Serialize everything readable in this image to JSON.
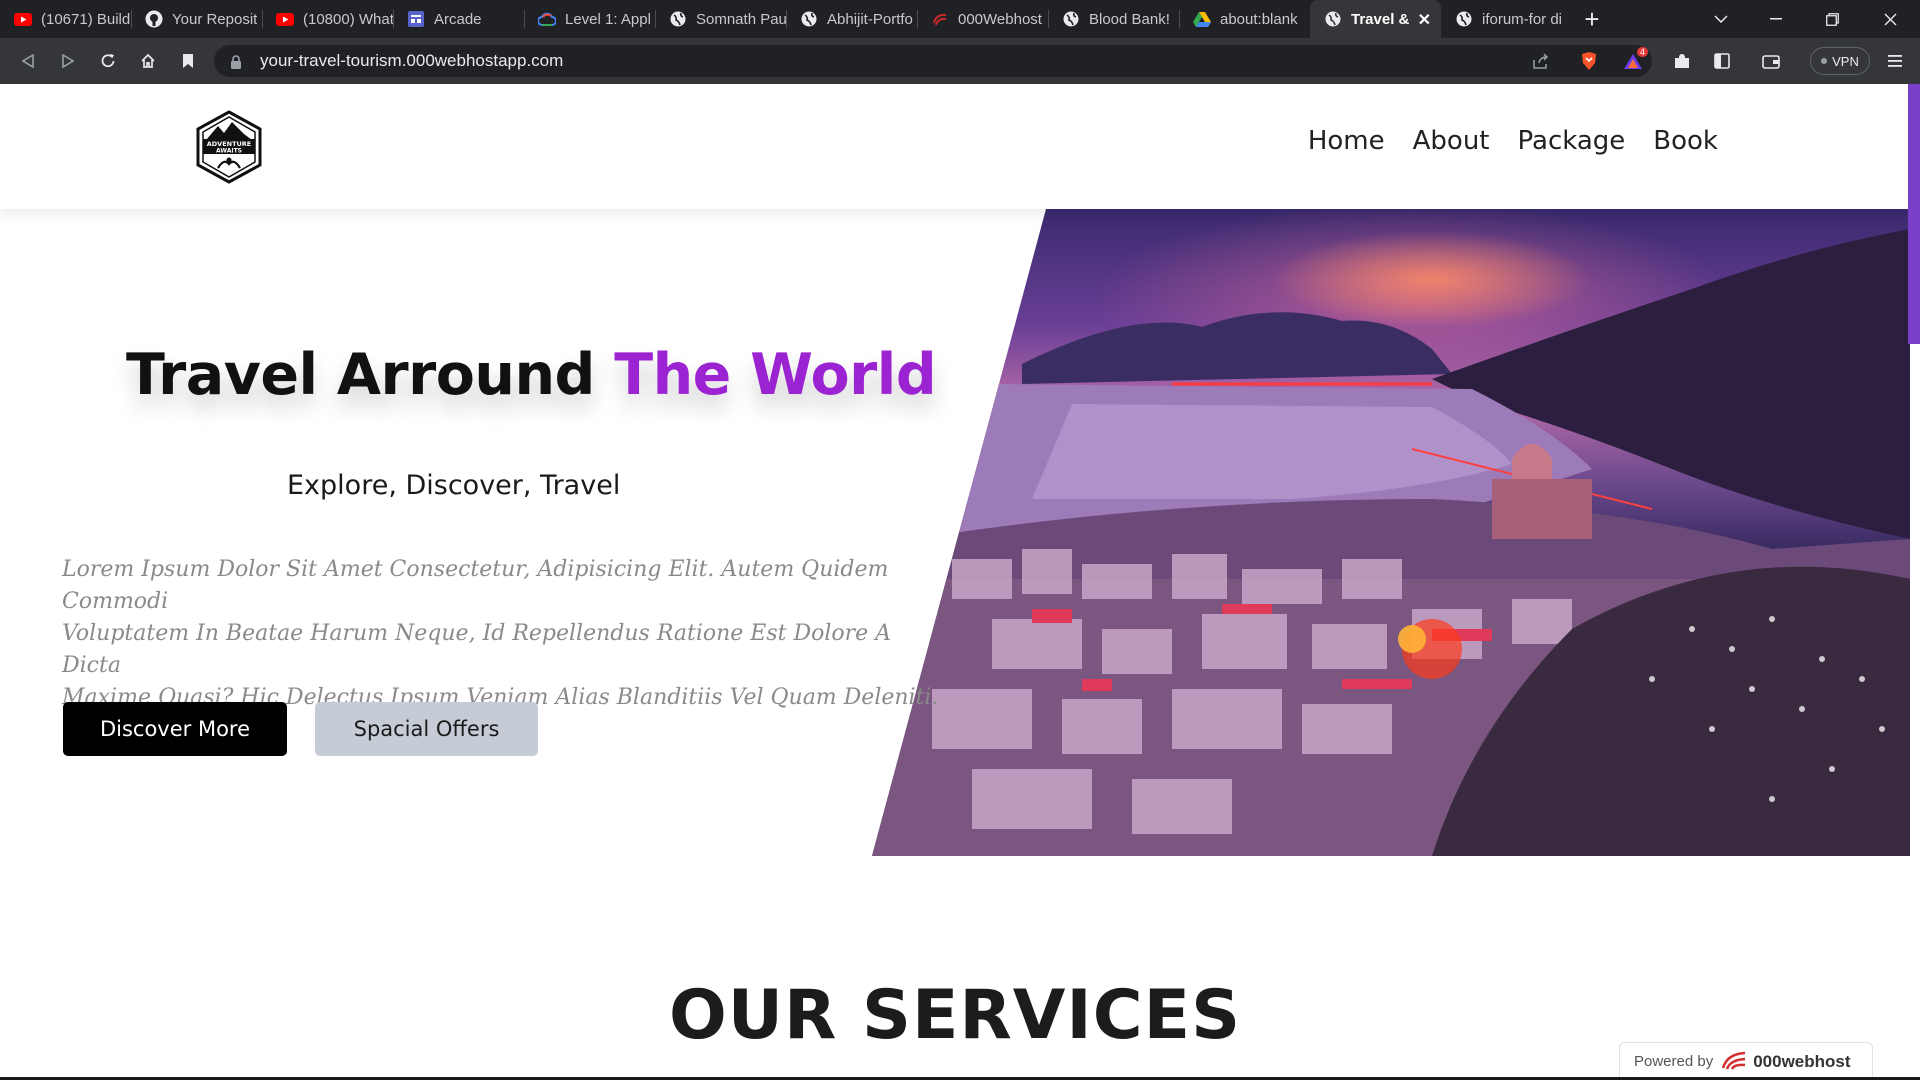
{
  "browser": {
    "tabs": [
      {
        "title": "(10671) Build",
        "icon": "youtube-icon"
      },
      {
        "title": "Your Reposit",
        "icon": "github-icon"
      },
      {
        "title": "(10800) What",
        "icon": "youtube-icon"
      },
      {
        "title": "Arcade",
        "icon": "arcade-icon"
      },
      {
        "title": "Level 1: Appl",
        "icon": "google-cloud-icon"
      },
      {
        "title": "Somnath Pau",
        "icon": "globe-icon"
      },
      {
        "title": "Abhijit-Portfo",
        "icon": "globe-icon"
      },
      {
        "title": "000Webhost",
        "icon": "webhost-icon"
      },
      {
        "title": "Blood Bank!",
        "icon": "globe-icon"
      },
      {
        "title": "about:blank",
        "icon": "google-drive-icon"
      },
      {
        "title": "Travel &",
        "icon": "globe-icon",
        "active": true
      },
      {
        "title": "iforum-for di",
        "icon": "globe-icon"
      }
    ],
    "new_tab_label": "+",
    "url": "your-travel-tourism.000webhostapp.com",
    "vpn_label": "VPN",
    "brave_badge": "4"
  },
  "site": {
    "logo_text_1": "ADVENTURE",
    "logo_text_2": "AWAITS",
    "nav": [
      "Home",
      "About",
      "Package",
      "Book"
    ],
    "hero": {
      "title_part1": "Travel Arround",
      "title_part2": "The World",
      "subtitle": "Explore, Discover, Travel",
      "text_line1": "Lorem Ipsum Dolor Sit Amet Consectetur, Adipisicing Elit. Autem Quidem Commodi",
      "text_line2": "Voluptatem In Beatae Harum Neque, Id Repellendus Ratione Est Dolore A Dicta",
      "text_line3": "Maxime Quasi? Hic Delectus Ipsum Veniam Alias Blanditiis Vel Quam Deleniti.",
      "btn_primary": "Discover More",
      "btn_secondary": "Spacial Offers"
    },
    "services_title": "OUR SERVICES",
    "powered_by": "Powered by",
    "powered_brand": "000webhost"
  },
  "colors": {
    "accent": "#9b23d1",
    "tabbar": "#202124",
    "toolbar": "#35363a"
  }
}
